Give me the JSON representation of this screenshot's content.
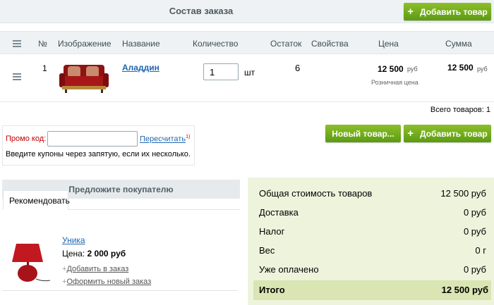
{
  "header": {
    "title": "Состав заказа",
    "add_button": "Добавить товар"
  },
  "table": {
    "columns": {
      "num": "№",
      "image": "Изображение",
      "name": "Название",
      "quantity": "Количество",
      "stock": "Остаток",
      "properties": "Свойства",
      "price": "Цена",
      "sum": "Сумма"
    },
    "rows": [
      {
        "num": "1",
        "name": "Аладдин",
        "quantity": "1",
        "unit": "шт",
        "stock": "6",
        "price": "12 500",
        "price_currency": "руб",
        "price_type": "Розничная цена",
        "sum": "12 500",
        "sum_currency": "руб"
      }
    ],
    "total_items": "Всего товаров: 1"
  },
  "promo": {
    "label": "Промо код:",
    "value": "",
    "recalc": "Пересчитать",
    "recalc_note": "1)",
    "hint": "Введите купоны через запятую, если их несколько."
  },
  "actions": {
    "new_product": "Новый товар...",
    "add_product": "Добавить товар"
  },
  "suggest": {
    "title": "Предложите покупателю",
    "tab": "Рекомендовать",
    "product": {
      "name": "Уника",
      "price_label": "Цена:",
      "price": "2 000 руб",
      "add_to_order": "Добавить в заказ",
      "new_order": "Оформить новый заказ"
    }
  },
  "totals": {
    "goods_label": "Общая стоимость товаров",
    "goods_value": "12 500 руб",
    "delivery_label": "Доставка",
    "delivery_value": "0 руб",
    "tax_label": "Налог",
    "tax_value": "0 руб",
    "weight_label": "Вес",
    "weight_value": "0 г",
    "paid_label": "Уже оплачено",
    "paid_value": "0 руб",
    "total_label": "Итого",
    "total_value": "12 500 руб"
  },
  "colors": {
    "green_button": "#6ea71b",
    "header_bg": "#eef2f4",
    "totals_bg": "#eef3dc",
    "link": "#2067b0",
    "promo_label": "#c00000"
  }
}
